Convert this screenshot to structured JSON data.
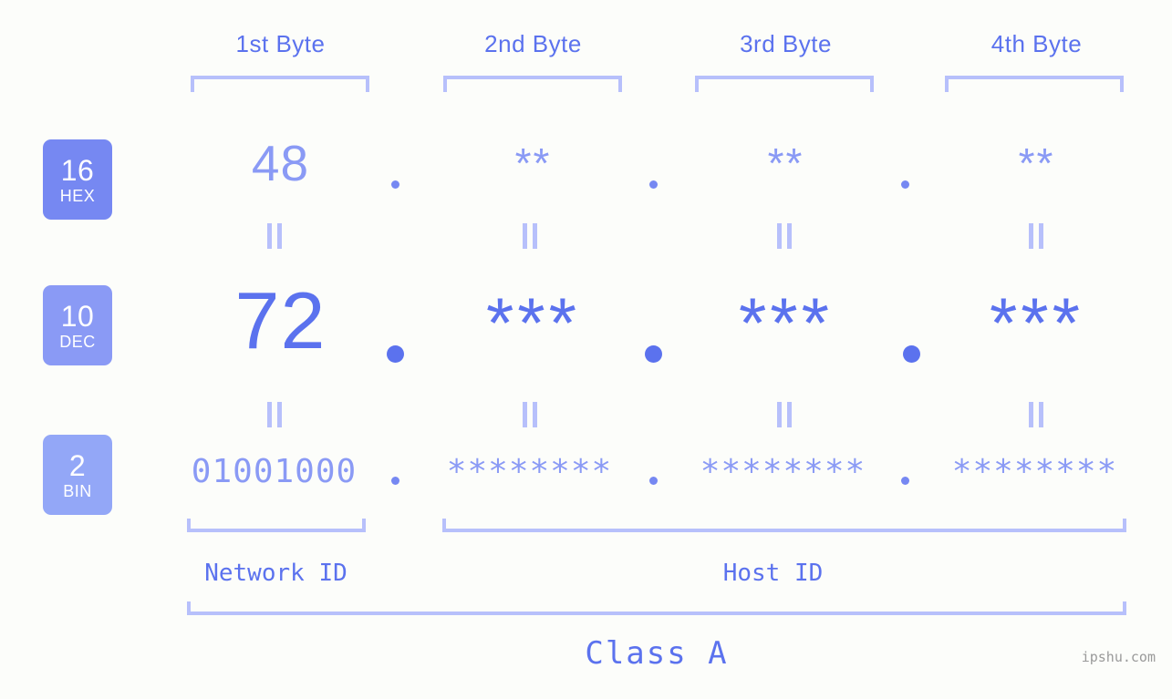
{
  "meta": {
    "background_color": "#fcfdfa",
    "accent_strong": "#5b72ee",
    "accent_mid": "#8a9af5",
    "accent_light": "#b7c0fb",
    "badge_hex_color": "#7688f2",
    "badge_dec_color": "#8a9af5",
    "badge_bin_color": "#93a7f7"
  },
  "headers": {
    "byte1": "1st Byte",
    "byte2": "2nd Byte",
    "byte3": "3rd Byte",
    "byte4": "4th Byte"
  },
  "badges": {
    "hex": {
      "num": "16",
      "unit": "HEX"
    },
    "dec": {
      "num": "10",
      "unit": "DEC"
    },
    "bin": {
      "num": "2",
      "unit": "BIN"
    }
  },
  "rows": {
    "hex": {
      "byte1": "48",
      "byte2": "**",
      "byte3": "**",
      "byte4": "**"
    },
    "dec": {
      "byte1": "72",
      "byte2": "***",
      "byte3": "***",
      "byte4": "***"
    },
    "bin": {
      "byte1": "01001000",
      "byte2": "********",
      "byte3": "********",
      "byte4": "********"
    }
  },
  "separators": {
    "dot": "."
  },
  "footer": {
    "network_id": "Network ID",
    "host_id": "Host ID",
    "class_label": "Class A"
  },
  "watermark": "ipshu.com"
}
